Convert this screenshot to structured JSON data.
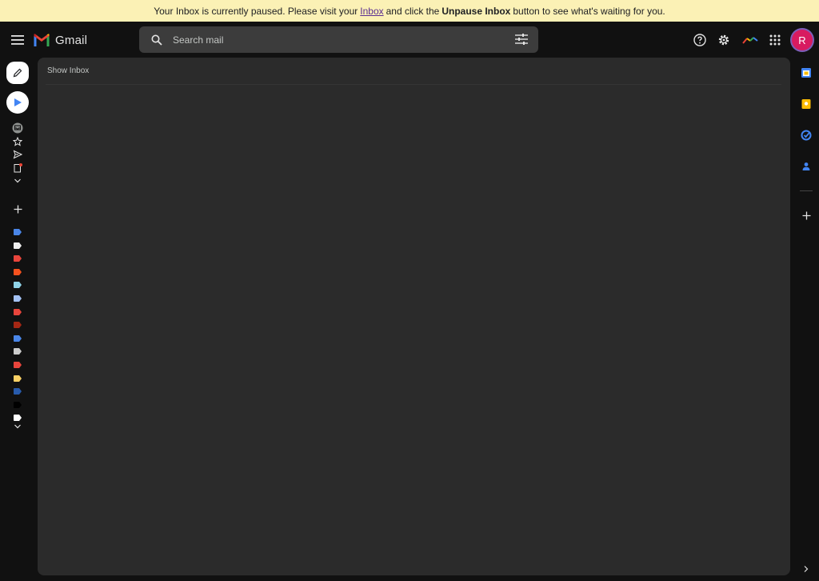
{
  "banner": {
    "text_before": "Your Inbox is currently paused. Please visit your",
    "link": "Inbox",
    "text_middle": "and click the",
    "bold": "Unpause Inbox",
    "text_after": "button to see what's waiting for you."
  },
  "header": {
    "app_name": "Gmail",
    "search_placeholder": "Search mail",
    "avatar_letter": "R"
  },
  "main": {
    "show_inbox": "Show Inbox"
  },
  "icons": {
    "menu": "menu-icon",
    "search": "search-icon",
    "tune": "tune-icon",
    "help": "help-icon",
    "settings": "gear-icon",
    "apps": "apps-grid-icon"
  },
  "labels": [
    {
      "color": "#4a86e8"
    },
    {
      "color": "#efefef"
    },
    {
      "color": "#e8453c"
    },
    {
      "color": "#f4511e"
    },
    {
      "color": "#8fd3e8"
    },
    {
      "color": "#a4c2f4"
    },
    {
      "color": "#e8453c"
    },
    {
      "color": "#a52714"
    },
    {
      "color": "#4a86e8"
    },
    {
      "color": "#cccccc"
    },
    {
      "color": "#e8453c"
    },
    {
      "color": "#fad165"
    },
    {
      "color": "#285bac"
    },
    {
      "color": "#000000"
    },
    {
      "color": "#ffffff"
    }
  ],
  "colors": {
    "banner_bg": "#fbf1b5",
    "panel_bg": "#2b2b2b",
    "page_bg": "#111111",
    "avatar_bg": "#d81b60"
  }
}
